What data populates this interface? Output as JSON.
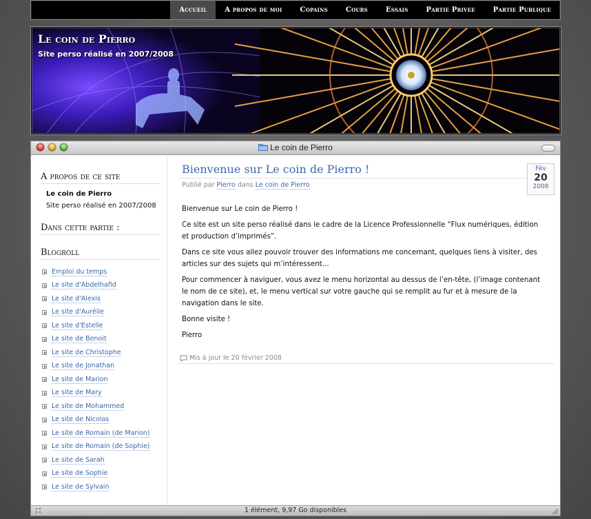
{
  "nav": {
    "items": [
      "Accueil",
      "A propos de moi",
      "Copains",
      "Cours",
      "Essais",
      "Partie Privee",
      "Partie Publique"
    ],
    "active": "Accueil"
  },
  "header": {
    "title": "Le coin de Pierro",
    "subtitle": "Site perso réalisé en 2007/2008"
  },
  "window": {
    "title": "Le coin de Pierro",
    "status": "1 élément, 9,97 Go disponibles"
  },
  "sidebar": {
    "about_heading": "A propos de ce site",
    "about_name": "Le coin de Pierro",
    "about_desc": "Site perso réalisé en 2007/2008",
    "section_heading": "Dans cette partie :",
    "blogroll_heading": "Blogroll",
    "blogroll": [
      "Emploi du temps",
      "Le site d'Abdelhafid",
      "Le site d'Alexis",
      "Le site d'Aurélie",
      "Le site d'Estelle",
      "Le site de Benoit",
      "Le site de Christophe",
      "Le site de Jonathan",
      "Le site de Marion",
      "Le site de Mary",
      "Le site de Mohammed",
      "Le site de Nicolas",
      "Le site de Romain (de Marion)",
      "Le site de Romain (de Sophie)",
      "Le site de Sarah",
      "Le site de Sophie",
      "Le site de Sylvain"
    ]
  },
  "post": {
    "title": "Bienvenue sur Le coin de Pierro !",
    "meta_prefix": "Publié par",
    "author": "Pierro",
    "meta_mid": "dans",
    "category": "Le coin de Pierro",
    "date_month": "Fév",
    "date_day": "20",
    "date_year": "2008",
    "paragraphs": [
      "Bienvenue sur Le coin de Pierro !",
      "Ce site est un site perso réalisé dans le cadre de la Licence Professionnelle “Flux numériques, édition et production d’imprimés”.",
      "Dans ce site vous allez pouvoir trouver des informations me concernant, quelques liens à visiter, des articles sur des sujets qui m’intéressent…",
      "Pour commencer à naviguer, vous avez le menu horizontal au dessus de l’en-tête, (l’image contenant le nom de ce site), et, le menu vertical sur votre gauche qui se remplit au fur et à mesure de la navigation dans le site.",
      "Bonne visite !",
      "Pierro"
    ],
    "updated": "Mis à jour le 20 février 2008"
  }
}
